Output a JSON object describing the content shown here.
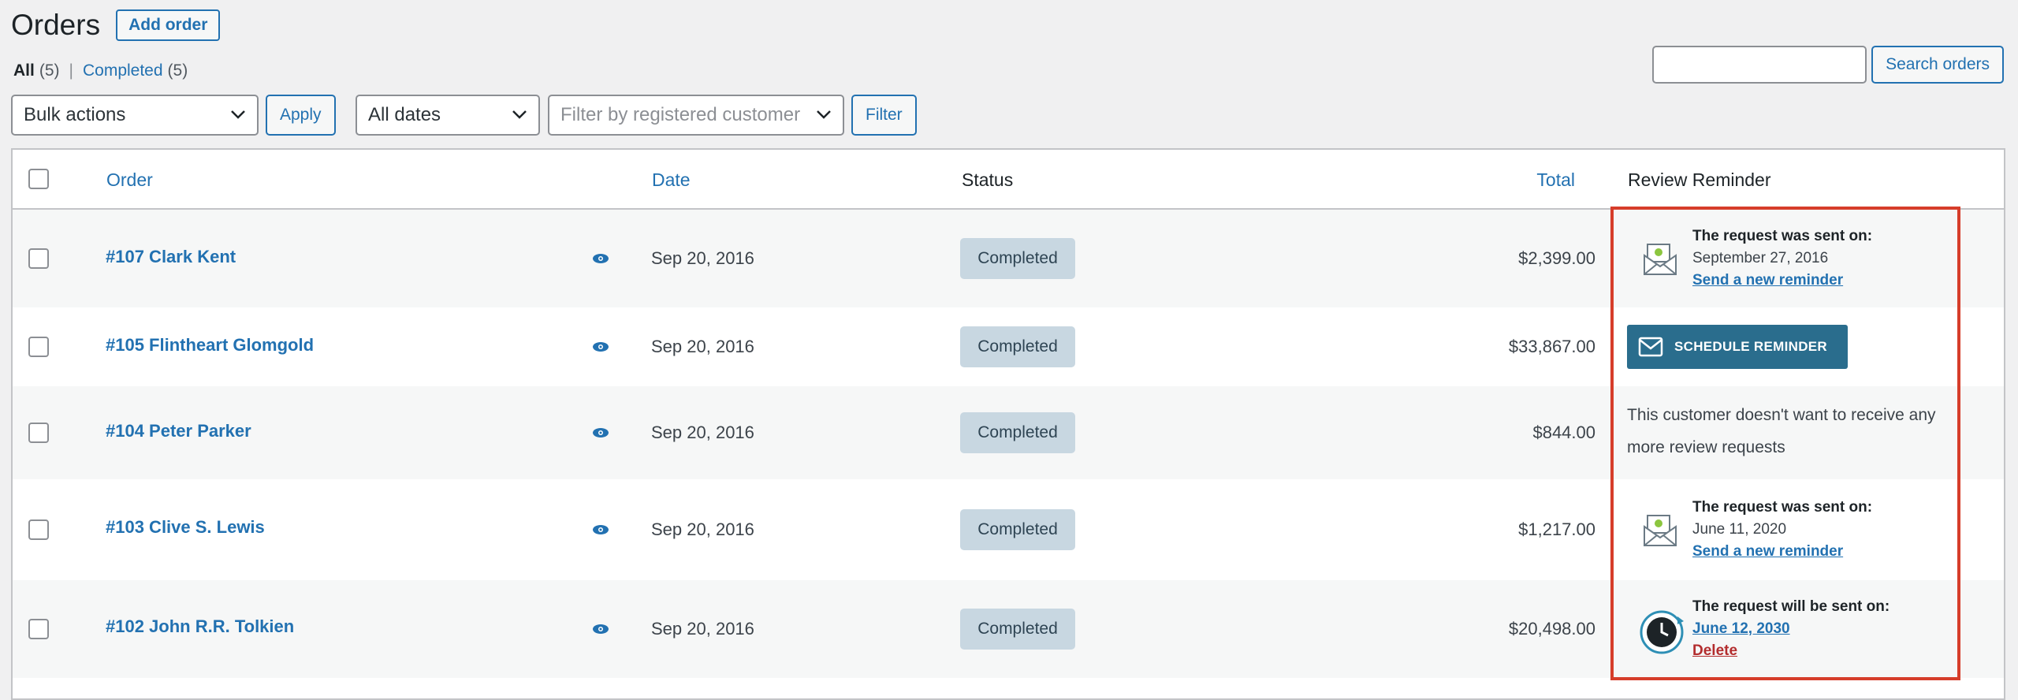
{
  "page": {
    "title": "Orders",
    "add_label": "Add order"
  },
  "views": {
    "all_label": "All",
    "all_count": "(5)",
    "separator": "|",
    "completed_label": "Completed",
    "completed_count": "(5)"
  },
  "search": {
    "button_label": "Search orders",
    "value": ""
  },
  "filters": {
    "bulk_actions": "Bulk actions",
    "apply_label": "Apply",
    "dates": "All dates",
    "customer_placeholder": "Filter by registered customer",
    "filter_label": "Filter"
  },
  "table": {
    "columns": {
      "order": "Order",
      "date": "Date",
      "status": "Status",
      "total": "Total",
      "review": "Review Reminder"
    },
    "rows": [
      {
        "order": "#107 Clark Kent",
        "date": "Sep 20, 2016",
        "status": "Completed",
        "total": "$2,399.00",
        "review": {
          "kind": "sent",
          "heading": "The request was sent on:",
          "date": "September 27, 2016",
          "link": "Send a new reminder"
        }
      },
      {
        "order": "#105 Flintheart Glomgold",
        "date": "Sep 20, 2016",
        "status": "Completed",
        "total": "$33,867.00",
        "review": {
          "kind": "button",
          "button_label": "SCHEDULE REMINDER"
        }
      },
      {
        "order": "#104 Peter Parker",
        "date": "Sep 20, 2016",
        "status": "Completed",
        "total": "$844.00",
        "review": {
          "kind": "optout",
          "text": "This customer doesn't want to receive any more review requests"
        }
      },
      {
        "order": "#103 Clive S. Lewis",
        "date": "Sep 20, 2016",
        "status": "Completed",
        "total": "$1,217.00",
        "review": {
          "kind": "sent",
          "heading": "The request was sent on:",
          "date": "June 11, 2020",
          "link": "Send a new reminder"
        }
      },
      {
        "order": "#102 John R.R. Tolkien",
        "date": "Sep 20, 2016",
        "status": "Completed",
        "total": "$20,498.00",
        "review": {
          "kind": "scheduled",
          "heading": "The request will be sent on:",
          "date": "June 12, 2030",
          "delete_label": "Delete"
        }
      }
    ]
  },
  "colors": {
    "link": "#2271b1",
    "status_bg": "#c8d7e1",
    "button_bg": "#2a6d8d",
    "highlight": "#d63d2a",
    "delete": "#b32d2e"
  },
  "icons": [
    "view-eye-icon",
    "envelope-check-icon",
    "mail-icon",
    "clock-icon",
    "chevron-down-icon"
  ]
}
